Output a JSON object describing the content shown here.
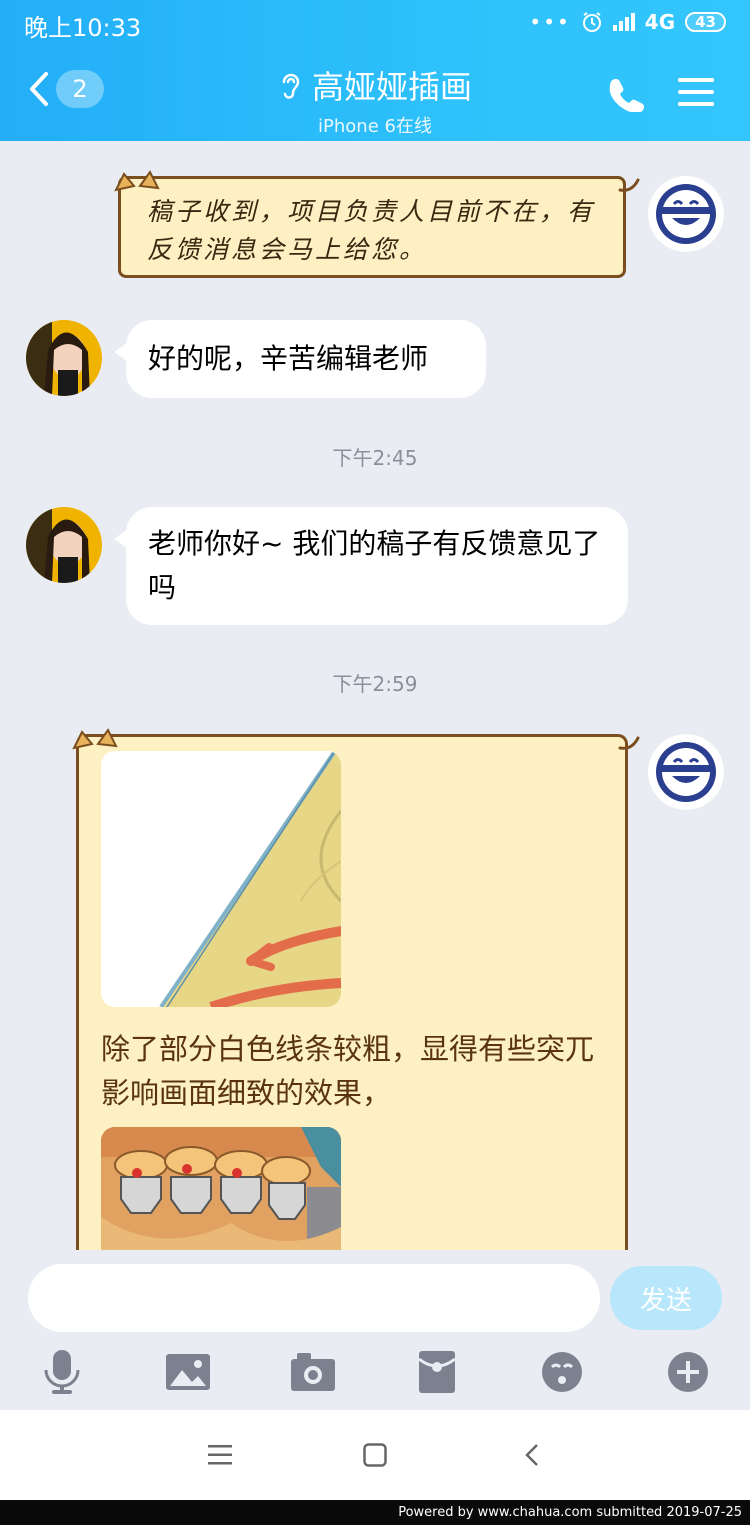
{
  "status_bar": {
    "time": "晚上10:33",
    "network": "4G",
    "battery": "43"
  },
  "header": {
    "back_count": "2",
    "title": "高娅娅插画",
    "subtitle": "iPhone 6在线"
  },
  "messages": {
    "m1": {
      "text": "稿子收到，项目负责人目前不在，有反馈消息会马上给您。"
    },
    "m2": {
      "text": "好的呢，辛苦编辑老师"
    },
    "t1": "下午2:45",
    "m3": {
      "text": "老师你好~ 我们的稿子有反馈意见了吗"
    },
    "t2": "下午2:59",
    "m4": {
      "text": "除了部分白色线条较粗，显得有些突兀影响画面细致的效果，"
    }
  },
  "input": {
    "send_label": "发送",
    "placeholder": ""
  },
  "footer": {
    "text": "Powered  by  www.chahua.com  submitted  2019-07-25"
  },
  "colors": {
    "header": "#2ec1fb",
    "card_bg": "#fdf1c4",
    "card_border": "#7a4e1e",
    "send_btn": "#b8e7fb"
  },
  "icons": [
    "back-icon",
    "ear-icon",
    "phone-icon",
    "menu-icon",
    "mic-icon",
    "image-icon",
    "camera-icon",
    "red-packet-icon",
    "emoji-icon",
    "plus-icon"
  ]
}
